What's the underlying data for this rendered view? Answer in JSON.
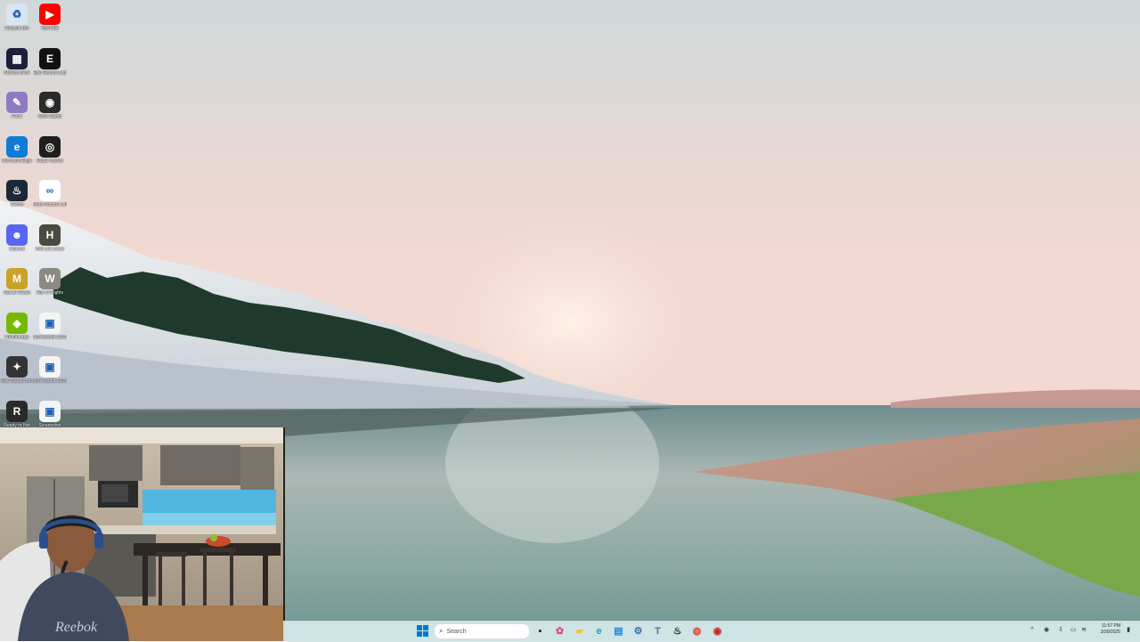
{
  "desktop": {
    "icons": [
      {
        "label": "Recycle Bin",
        "icon": "recycle-bin-icon",
        "color": "#d9e4f0"
      },
      {
        "label": "YouTube",
        "icon": "youtube-icon",
        "color": "#ff0000"
      },
      {
        "label": "Stream Deck",
        "icon": "stream-deck-icon",
        "color": "#1b1f3a"
      },
      {
        "label": "Epic Games Launcher",
        "icon": "epic-games-icon",
        "color": "#111111"
      },
      {
        "label": "Paint",
        "icon": "paint-icon",
        "color": "#8e7cc3"
      },
      {
        "label": "OBS Studio",
        "icon": "obs-icon",
        "color": "#2b2b2b"
      },
      {
        "label": "Microsoft Edge",
        "icon": "edge-icon",
        "color": "#0f7bd4"
      },
      {
        "label": "Razer Cortex",
        "icon": "razer-icon",
        "color": "#1e1e1e"
      },
      {
        "label": "Steam",
        "icon": "steam-icon",
        "color": "#1b2838"
      },
      {
        "label": "Meta Horizon Link",
        "icon": "meta-icon",
        "color": "#ffffff"
      },
      {
        "label": "Discord",
        "icon": "discord-icon",
        "color": "#5865f2"
      },
      {
        "label": "Hell Let Loose",
        "icon": "game-hll-icon",
        "color": "#4a4a40"
      },
      {
        "label": "Marvel Rivals",
        "icon": "marvel-rivals-icon",
        "color": "#c9a227"
      },
      {
        "label": "War of Rights",
        "icon": "war-of-rights-icon",
        "color": "#8a8a80"
      },
      {
        "label": "NVIDIA App",
        "icon": "nvidia-icon",
        "color": "#76b900"
      },
      {
        "label": "Screenshot 2025-03-...",
        "icon": "image-file-icon",
        "color": "#f4f4f4"
      },
      {
        "label": "Elite Dangerous",
        "icon": "elite-dangerous-icon",
        "color": "#333333"
      },
      {
        "label": "Screenshot 2025-03-...",
        "icon": "image-file-icon",
        "color": "#f4f4f4"
      },
      {
        "label": "Ready or Not",
        "icon": "ready-or-not-icon",
        "color": "#2a2a2a"
      },
      {
        "label": "Screenshot",
        "icon": "image-file-icon",
        "color": "#f4f4f4"
      }
    ]
  },
  "taskbar": {
    "search_placeholder": "Search",
    "apps": [
      {
        "name": "start-button",
        "icon": "windows-icon",
        "color": "#0078d4"
      },
      {
        "name": "task-view-button",
        "icon": "task-view-icon",
        "color": "#222222"
      },
      {
        "name": "copilot-button",
        "icon": "copilot-icon",
        "color": "#e0457b"
      },
      {
        "name": "file-explorer-button",
        "icon": "folder-icon",
        "color": "#f5c242"
      },
      {
        "name": "edge-button",
        "icon": "edge-icon",
        "color": "#0f9bd4"
      },
      {
        "name": "store-button",
        "icon": "store-icon",
        "color": "#1e88e5"
      },
      {
        "name": "settings-button",
        "icon": "settings-icon",
        "color": "#3a6ea5"
      },
      {
        "name": "teams-button",
        "icon": "teams-icon",
        "color": "#6264a7"
      },
      {
        "name": "steam-button",
        "icon": "steam-icon",
        "color": "#1b2838"
      },
      {
        "name": "chrome-button",
        "icon": "chrome-icon",
        "color": "#db4437"
      },
      {
        "name": "obs-button",
        "icon": "obs-icon",
        "color": "#c62828"
      }
    ],
    "tray": {
      "clock_time": "11:57 PM",
      "clock_date": "3/30/2025"
    }
  },
  "webcam": {
    "shirt_text": "Reebok"
  },
  "colors": {
    "taskbar_bg": "#d6eaeb",
    "accent": "#0078d4"
  }
}
